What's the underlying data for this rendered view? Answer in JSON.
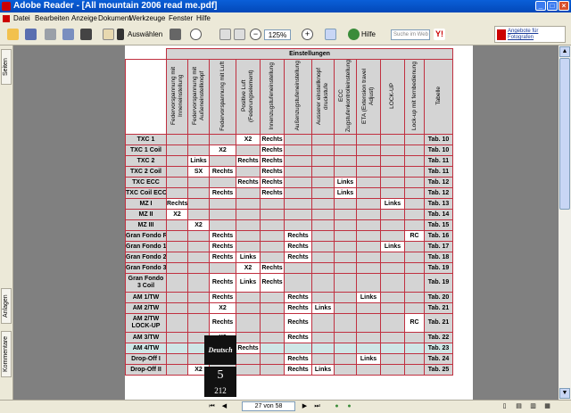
{
  "window": {
    "title": "Adobe Reader - [All mountain 2006 read me.pdf]"
  },
  "menu": [
    "Datei",
    "Bearbeiten",
    "Anzeige",
    "Dokument",
    "Werkzeuge",
    "Fenster",
    "Hilfe"
  ],
  "toolbar": {
    "select_label": "Auswählen",
    "zoom_value": "125%",
    "help_label": "Hilfe",
    "search_placeholder": "Suche im Web",
    "promo_text": "Angebote für Fotografen"
  },
  "side_tabs": [
    "Seiten",
    "Anlagen",
    "Kommentare"
  ],
  "status": {
    "page_indicator": "27 von 58"
  },
  "table": {
    "group_header": "Einstellungen",
    "columns": [
      "Federvorspannung mit Inneneinstellung",
      "Federvorspannung mit Außeneinstellknopf",
      "Federvorspannung mit Luft",
      "Positive Luft (Federungselement)",
      "Innenzugstufeneinstellung",
      "Außenzugstufeneinstellung",
      "Ausserer einstellknopf druckstufe",
      "ECC Zugstufenkontrolleinstellung",
      "ETA (Extension travel Adjust)",
      "LOCK-UP",
      "Lock-up mit fernbedienung",
      "Tabelle"
    ],
    "rows": [
      {
        "name": "TXC 1",
        "cells": [
          "",
          "",
          "",
          "X2",
          "Rechts",
          "",
          "",
          "",
          "",
          "",
          "",
          ""
        ],
        "tab": "Tab. 10"
      },
      {
        "name": "TXC 1 Coil",
        "cells": [
          "",
          "",
          "X2",
          "",
          "Rechts",
          "",
          "",
          "",
          "",
          "",
          "",
          ""
        ],
        "tab": "Tab. 10"
      },
      {
        "name": "TXC 2",
        "cells": [
          "",
          "Links",
          "",
          "Rechts",
          "Rechts",
          "",
          "",
          "",
          "",
          "",
          "",
          ""
        ],
        "tab": "Tab. 11"
      },
      {
        "name": "TXC 2 Coil",
        "cells": [
          "",
          "SX",
          "Rechts",
          "",
          "Rechts",
          "",
          "",
          "",
          "",
          "",
          "",
          ""
        ],
        "tab": "Tab. 11"
      },
      {
        "name": "TXC  ECC",
        "cells": [
          "",
          "",
          "",
          "Rechts",
          "Rechts",
          "",
          "",
          "Links",
          "",
          "",
          "",
          ""
        ],
        "tab": "Tab. 12"
      },
      {
        "name": "TXC Coil ECC",
        "cells": [
          "",
          "",
          "Rechts",
          "",
          "Rechts",
          "",
          "",
          "Links",
          "",
          "",
          "",
          ""
        ],
        "tab": "Tab. 12"
      },
      {
        "name": "MZ I",
        "cells": [
          "Rechts",
          "",
          "",
          "",
          "",
          "",
          "",
          "",
          "",
          "Links",
          "",
          ""
        ],
        "tab": "Tab. 13"
      },
      {
        "name": "MZ II",
        "cells": [
          "X2",
          "",
          "",
          "",
          "",
          "",
          "",
          "",
          "",
          "",
          "",
          ""
        ],
        "tab": "Tab. 14"
      },
      {
        "name": "MZ III",
        "cells": [
          "",
          "X2",
          "",
          "",
          "",
          "",
          "",
          "",
          "",
          "",
          "",
          ""
        ],
        "tab": "Tab. 15"
      },
      {
        "name": "Gran Fondo RC",
        "cells": [
          "",
          "",
          "Rechts",
          "",
          "",
          "Rechts",
          "",
          "",
          "",
          "",
          "RC",
          ""
        ],
        "tab": "Tab. 16"
      },
      {
        "name": "Gran Fondo 1",
        "cells": [
          "",
          "",
          "Rechts",
          "",
          "",
          "Rechts",
          "",
          "",
          "",
          "Links",
          "",
          ""
        ],
        "tab": "Tab. 17"
      },
      {
        "name": "Gran Fondo 2",
        "cells": [
          "",
          "",
          "Rechts",
          "Links",
          "",
          "Rechts",
          "",
          "",
          "",
          "",
          "",
          ""
        ],
        "tab": "Tab. 18"
      },
      {
        "name": "Gran Fondo 3",
        "cells": [
          "",
          "",
          "",
          "X2",
          "Rechts",
          "",
          "",
          "",
          "",
          "",
          "",
          ""
        ],
        "tab": "Tab. 19"
      },
      {
        "name": "Gran Fondo 3 Coil",
        "cells": [
          "",
          "",
          "Rechts",
          "Links",
          "Rechts",
          "",
          "",
          "",
          "",
          "",
          "",
          ""
        ],
        "tab": "Tab. 19"
      },
      {
        "name": "AM 1/TW",
        "cells": [
          "",
          "",
          "Rechts",
          "",
          "",
          "Rechts",
          "",
          "",
          "Links",
          "",
          "",
          ""
        ],
        "tab": "Tab. 20"
      },
      {
        "name": "AM 2/TW",
        "cells": [
          "",
          "",
          "X2",
          "",
          "",
          "Rechts",
          "Links",
          "",
          "",
          "",
          "",
          ""
        ],
        "tab": "Tab. 21"
      },
      {
        "name": "AM 2/TW LOCK-UP",
        "cells": [
          "",
          "",
          "Rechts",
          "",
          "",
          "Rechts",
          "",
          "",
          "",
          "",
          "RC",
          ""
        ],
        "tab": "Tab. 21"
      },
      {
        "name": "AM 3/TW",
        "cells": [
          "",
          "",
          "X2",
          "",
          "",
          "Rechts",
          "",
          "",
          "",
          "",
          "",
          ""
        ],
        "tab": "Tab. 22"
      },
      {
        "name": "AM 4/TW",
        "cells": [
          "",
          "",
          "X2",
          "Rechts",
          "",
          "",
          "",
          "",
          "",
          "",
          "",
          ""
        ],
        "tab": "Tab. 23",
        "highlight": true
      },
      {
        "name": "Drop-Off I",
        "cells": [
          "",
          "",
          "Rechts",
          "",
          "",
          "Rechts",
          "",
          "",
          "Links",
          "",
          "",
          ""
        ],
        "tab": "Tab. 24"
      },
      {
        "name": "Drop-Off II",
        "cells": [
          "",
          "X2",
          "",
          "",
          "",
          "Rechts",
          "Links",
          "",
          "",
          "",
          "",
          ""
        ],
        "tab": "Tab. 25"
      }
    ]
  },
  "page_side": {
    "language": "Deutsch",
    "chapter": "5",
    "page": "212"
  }
}
